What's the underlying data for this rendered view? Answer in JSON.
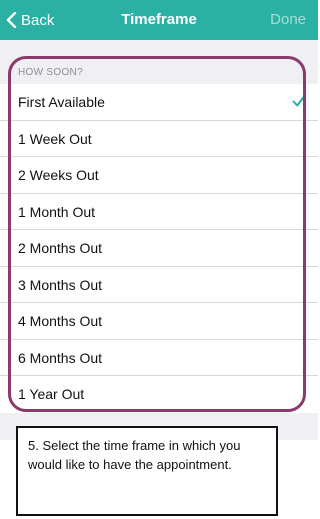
{
  "navbar": {
    "back_label": "Back",
    "title": "Timeframe",
    "done_label": "Done"
  },
  "section": {
    "header": "HOW SOON?"
  },
  "options": [
    {
      "label": "First Available",
      "selected": true
    },
    {
      "label": "1 Week Out",
      "selected": false
    },
    {
      "label": "2 Weeks Out",
      "selected": false
    },
    {
      "label": "1 Month Out",
      "selected": false
    },
    {
      "label": "2 Months Out",
      "selected": false
    },
    {
      "label": "3 Months Out",
      "selected": false
    },
    {
      "label": "4 Months Out",
      "selected": false
    },
    {
      "label": "6 Months Out",
      "selected": false
    },
    {
      "label": "1 Year Out",
      "selected": false
    }
  ],
  "callout": {
    "text": "5. Select the time frame in which you would like to have the appointment."
  },
  "colors": {
    "nav_teal": "#2bb0a4",
    "checkmark_teal": "#2bb0a4",
    "highlight_border": "#8a3a6b",
    "background_gray": "#efeff4"
  },
  "icons": {
    "back": "chevron-left-icon",
    "selected": "checkmark-icon"
  }
}
